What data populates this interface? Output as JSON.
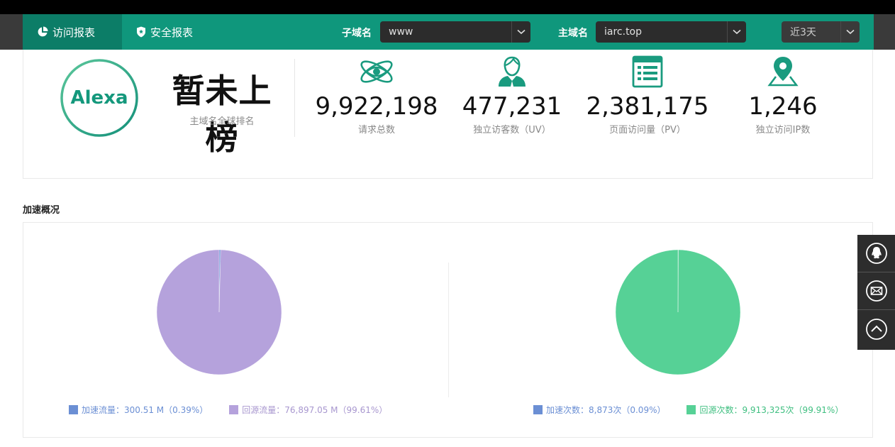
{
  "nav": {
    "tabs": [
      {
        "label": "访问报表",
        "icon": "pie-chart-icon",
        "active": true
      },
      {
        "label": "安全报表",
        "icon": "shield-icon",
        "active": false
      }
    ],
    "subdomain": {
      "label": "子域名",
      "value": "www"
    },
    "maindomain": {
      "label": "主域名",
      "value": "iarc.top"
    },
    "range": {
      "value": "近3天"
    }
  },
  "rank": {
    "badge": "Alexa",
    "title": "暂未上榜",
    "subtitle": "主域名全球排名"
  },
  "stats": [
    {
      "value": "9,922,198",
      "label": "请求总数",
      "icon": "atom-eye-icon"
    },
    {
      "value": "477,231",
      "label": "独立访客数（UV）",
      "icon": "user-icon"
    },
    {
      "value": "2,381,175",
      "label": "页面访问量（PV）",
      "icon": "page-icon"
    },
    {
      "value": "1,246",
      "label": "独立访问IP数",
      "icon": "location-pin-icon"
    }
  ],
  "section_title": "加速概况",
  "colors": {
    "brand": "#0f977c",
    "accel": "#6b8fd4",
    "origin_traffic": "#b5a2dc",
    "origin_hits": "#56d196"
  },
  "chart_data": [
    {
      "type": "pie",
      "labels": [
        "加速流量",
        "回源流量"
      ],
      "values": [
        300.51,
        76897.05
      ],
      "percentages": [
        0.39,
        99.61
      ],
      "legend": [
        "加速流量：300.51 M（0.39%）",
        "回源流量：76,897.05 M（99.61%）"
      ],
      "colors": [
        "#6b8fd4",
        "#b5a2dc"
      ],
      "legend_position": "bottom"
    },
    {
      "type": "pie",
      "labels": [
        "加速次数",
        "回源次数"
      ],
      "values": [
        8873,
        9913325
      ],
      "percentages": [
        0.09,
        99.91
      ],
      "legend": [
        "加速次数：8,873次（0.09%）",
        "回源次数：9,913,325次（99.91%）"
      ],
      "colors": [
        "#6b8fd4",
        "#56d196"
      ],
      "legend_position": "bottom"
    }
  ],
  "side_tools": [
    {
      "icon": "qq-icon"
    },
    {
      "icon": "mail-icon"
    },
    {
      "icon": "back-to-top-icon"
    }
  ]
}
